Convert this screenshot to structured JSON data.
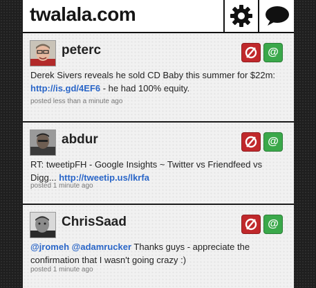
{
  "app": {
    "title": "twalala.com"
  },
  "header": {
    "settings_icon": "gear-icon",
    "compose_icon": "speech-bubble-icon"
  },
  "colors": {
    "block_button": "#c0282b",
    "reply_button": "#3aa84a",
    "link": "#2a66c8"
  },
  "tweets": [
    {
      "user": "peterc",
      "text_before": "Derek Sivers reveals he sold CD Baby this summer for $22m:",
      "link": "http://is.gd/4EF6",
      "text_after": " - he had 100% equity.",
      "time": "posted less than a minute ago",
      "reply_label": "@"
    },
    {
      "user": "abdur",
      "text_before": "RT: tweetipFH - Google Insights ~ Twitter vs Friendfeed vs Digg... ",
      "link": "http://tweetip.us/lkrfa",
      "text_after": "",
      "time": "posted 1 minute ago",
      "reply_label": "@"
    },
    {
      "user": "ChrisSaad",
      "mention1": "@jromeh",
      "mention2": "@adamrucker",
      "text_after": " Thanks guys - appreciate the confirmation that I wasn't going crazy :)",
      "time": "posted 1 minute ago",
      "reply_label": "@"
    }
  ]
}
